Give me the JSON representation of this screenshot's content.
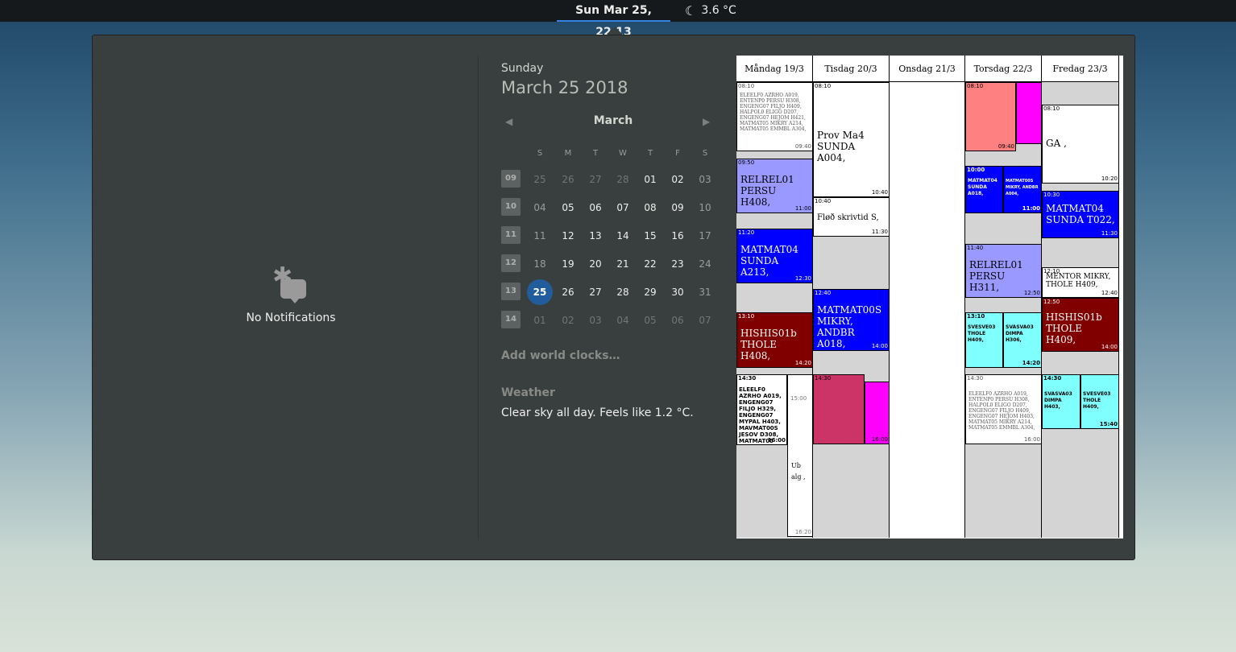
{
  "topbar": {
    "clock": "Sun Mar 25, 22:13",
    "temperature": "3.6 °C",
    "weather_icon": "moon-icon"
  },
  "notifications": {
    "empty_label": "No Notifications",
    "icon": "notifications-empty-icon"
  },
  "date": {
    "day_name": "Sunday",
    "full_date": "March 25 2018"
  },
  "calendar": {
    "month": "March",
    "day_headers": [
      "S",
      "M",
      "T",
      "W",
      "T",
      "F",
      "S"
    ],
    "weeks": [
      {
        "wk": "09",
        "days": [
          "25",
          "26",
          "27",
          "28",
          "01",
          "02",
          "03"
        ]
      },
      {
        "wk": "10",
        "days": [
          "04",
          "05",
          "06",
          "07",
          "08",
          "09",
          "10"
        ]
      },
      {
        "wk": "11",
        "days": [
          "11",
          "12",
          "13",
          "14",
          "15",
          "16",
          "17"
        ]
      },
      {
        "wk": "12",
        "days": [
          "18",
          "19",
          "20",
          "21",
          "22",
          "23",
          "24"
        ]
      },
      {
        "wk": "13",
        "days": [
          "25",
          "26",
          "27",
          "28",
          "29",
          "30",
          "31"
        ]
      },
      {
        "wk": "14",
        "days": [
          "01",
          "02",
          "03",
          "04",
          "05",
          "06",
          "07"
        ]
      }
    ],
    "today": "25"
  },
  "world_clocks": "Add world clocks…",
  "weather": {
    "title": "Weather",
    "description": "Clear sky all day. Feels like 1.2 °C."
  },
  "schedule": {
    "days": [
      "Måndag 19/3",
      "Tisdag 20/3",
      "Onsdag 21/3",
      "Torsdag 22/3",
      "Fredag 23/3"
    ],
    "blocks": {
      "mon1": "ELEELF0 AZRHO A019, ENTENP0 PERSU H308, ENGENG07 FILJO H409, HALPOL0 ELIGO D207, ENGENG07 HEJOM H421, MATMAT05 MIKRY A214, MATMAT05 EMMBL A304,",
      "mon2": "RELREL01 PERSU H408,",
      "mon3": "MATMAT04 SUNDA A213,",
      "mon4": "HISHIS01b THOLE H408,",
      "mon5": "ELEELF0 AZRHO A019, ENGENG07 FILJO H329, ENGENG07 MYPAL H403, MAVMAT00S JESOV D308, MATMAT05 ANDDA A124,",
      "mon6": "Ub alg ,",
      "tue1": "Prov Ma4 SUNDA A004,",
      "tue2": "Fløð skrivtid S,",
      "tue3": "MATMAT00S MIKRY, ANDBR A018,",
      "fri1": "GA ,",
      "fri2": "MATMAT04 SUNDA T022,",
      "fri3": "MENTOR MIKRY, THOLE H409,",
      "fri4": "HISHIS01b THOLE H409,",
      "fri5": "SVASVA03 DIMPA H403,",
      "fri6": "SVESVE03 THOLE H409,",
      "thu1": "MATMAT04 SUNDA A018,",
      "thu2": "MATMAT00S MIKRY, ANDBR A004,",
      "thu3": "RELREL01 PERSU H311,",
      "thu4": "SVESVE03 THOLE H409,",
      "thu5": "SVASVA03 DIMPA H306,",
      "thu6": "ELEELF0 AZRHO A019, ENTENP0 PERSU H308, HALPOL0 ELIGO D207, ENGENG07 FILJO H409, ENGENG07 HEJOM H403, MATMAT05 MIKRY A214, MATMAT05 EMMBL A304,"
    },
    "times": {
      "t0810": "08:10",
      "t0940": "09:40",
      "t0950": "09:50",
      "t1100": "11:00",
      "t1120": "11:20",
      "t1230": "12:30",
      "t1310": "13:10",
      "t1420": "14:20",
      "t1430": "14:30",
      "t1600": "16:00",
      "t1040": "10:40",
      "t1130": "11:30",
      "t1240": "12:40",
      "t1400": "14:00",
      "t1000": "10:00",
      "t1020": "10:20",
      "t1030": "10:30",
      "t1140": "11:40",
      "t1250": "12:50",
      "t1210": "12:10",
      "t1540": "15:40",
      "t1500": "15:00",
      "t1620": "16:20"
    }
  }
}
